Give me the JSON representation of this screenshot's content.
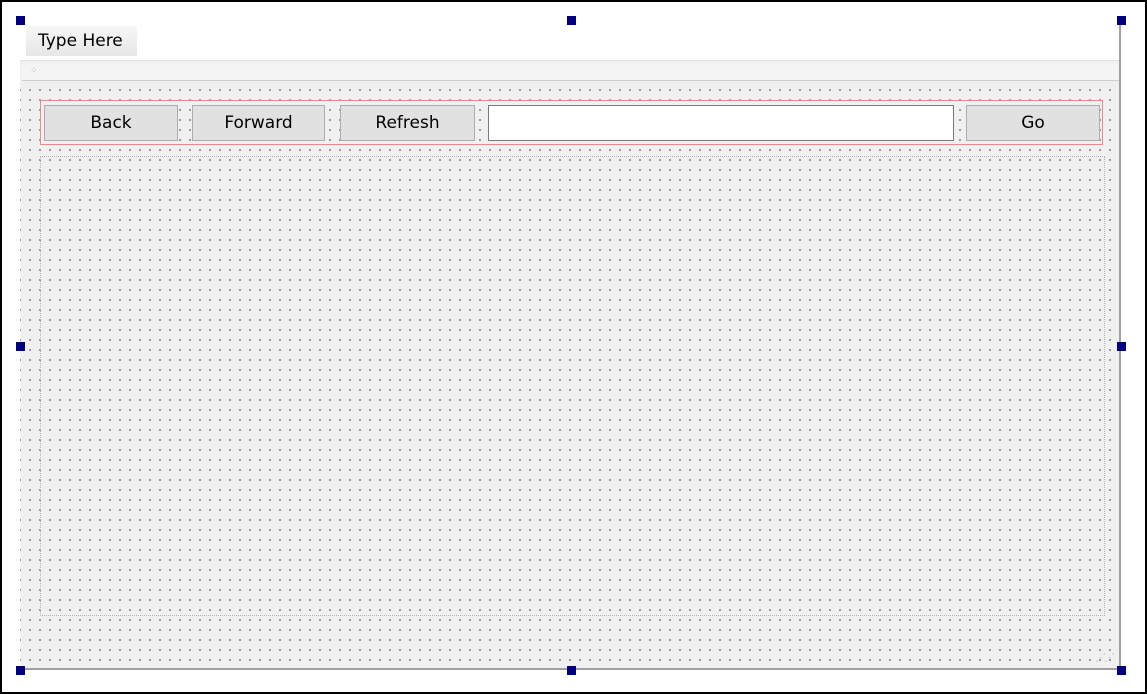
{
  "menubar": {
    "items": [
      {
        "label": "Type Here"
      }
    ]
  },
  "toolbar": {
    "back_label": "Back",
    "forward_label": "Forward",
    "refresh_label": "Refresh",
    "url_value": "",
    "go_label": "Go"
  },
  "colors": {
    "selection_handle": "#000080",
    "layout_border": "#e8898c",
    "form_background": "#f0f0f0"
  }
}
